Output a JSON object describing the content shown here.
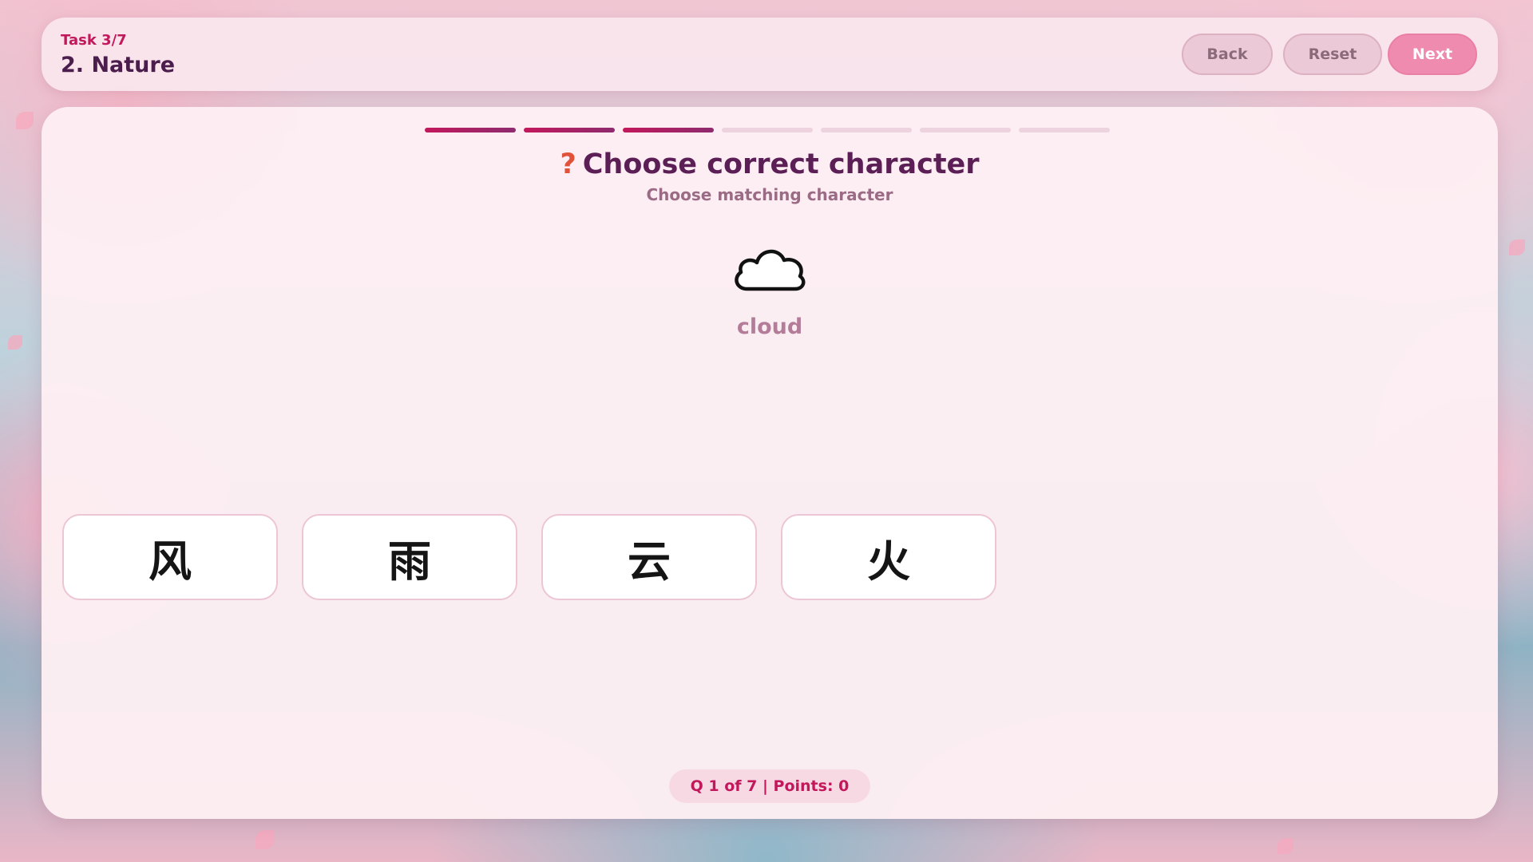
{
  "header": {
    "task_label": "Task 3/7",
    "title": "2. Nature",
    "buttons": {
      "back": "Back",
      "reset": "Reset",
      "next": "Next"
    }
  },
  "progress": {
    "total_segments": 7,
    "completed_segments": 3
  },
  "question": {
    "icon": "question-mark-icon",
    "symbol": "?",
    "title": "Choose correct character",
    "subtitle": "Choose matching character",
    "image_icon": "cloud-icon",
    "prompt_word": "cloud"
  },
  "choices": [
    {
      "label": "风"
    },
    {
      "label": "雨"
    },
    {
      "label": "云"
    },
    {
      "label": "火"
    }
  ],
  "status": {
    "text": "Q 1 of 7 | Points: 0"
  },
  "colors": {
    "accent": "#c2185b",
    "title": "#4a1d4d",
    "next_button": "#f08bb0",
    "progress_done": "#a3245f",
    "progress_todo": "#ecd3dd"
  }
}
